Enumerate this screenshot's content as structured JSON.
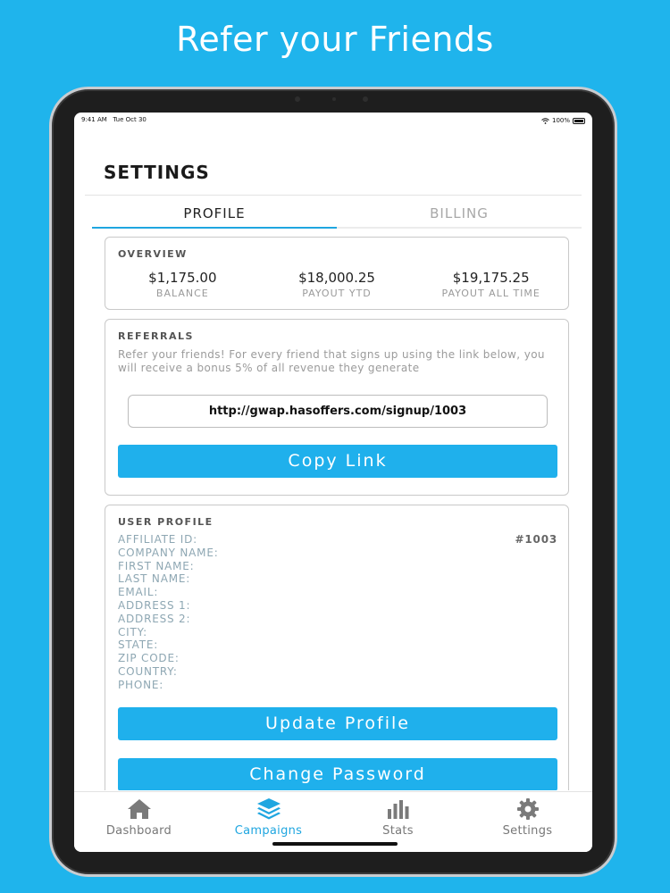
{
  "promo": {
    "headline": "Refer your Friends"
  },
  "status_bar": {
    "time": "9:41 AM",
    "date": "Tue Oct 30",
    "battery": "100%"
  },
  "header": {
    "title": "SETTINGS"
  },
  "tabs": [
    {
      "label": "PROFILE",
      "active": true
    },
    {
      "label": "BILLING",
      "active": false
    }
  ],
  "overview": {
    "title": "OVERVIEW",
    "stats": [
      {
        "value": "$1,175.00",
        "label": "BALANCE"
      },
      {
        "value": "$18,000.25",
        "label": "PAYOUT YTD"
      },
      {
        "value": "$19,175.25",
        "label": "PAYOUT ALL TIME"
      }
    ]
  },
  "referrals": {
    "title": "REFERRALS",
    "description": "Refer your friends! For every friend that signs up using the link below, you will receive a bonus 5% of all revenue they generate",
    "link": "http://gwap.hasoffers.com/signup/1003",
    "copy_button": "Copy Link"
  },
  "user_profile": {
    "title": "USER PROFILE",
    "fields": [
      {
        "label": "AFFILIATE ID:",
        "value": "#1003"
      },
      {
        "label": "COMPANY NAME:",
        "value": ""
      },
      {
        "label": "FIRST NAME:",
        "value": ""
      },
      {
        "label": "LAST NAME:",
        "value": ""
      },
      {
        "label": "EMAIL:",
        "value": ""
      },
      {
        "label": "ADDRESS 1:",
        "value": ""
      },
      {
        "label": "ADDRESS 2:",
        "value": ""
      },
      {
        "label": "CITY:",
        "value": ""
      },
      {
        "label": "STATE:",
        "value": ""
      },
      {
        "label": "ZIP CODE:",
        "value": ""
      },
      {
        "label": "COUNTRY:",
        "value": ""
      },
      {
        "label": "PHONE:",
        "value": ""
      }
    ],
    "update_button": "Update Profile",
    "password_button": "Change Password"
  },
  "tab_bar": [
    {
      "label": "Dashboard",
      "icon": "home-icon",
      "active": false
    },
    {
      "label": "Campaigns",
      "icon": "layers-icon",
      "active": true
    },
    {
      "label": "Stats",
      "icon": "bar-chart-icon",
      "active": false
    },
    {
      "label": "Settings",
      "icon": "gear-icon",
      "active": false
    }
  ],
  "colors": {
    "accent": "#1fb0ec",
    "background": "#1fb4ec",
    "active_tab": "#1fa6e0"
  }
}
